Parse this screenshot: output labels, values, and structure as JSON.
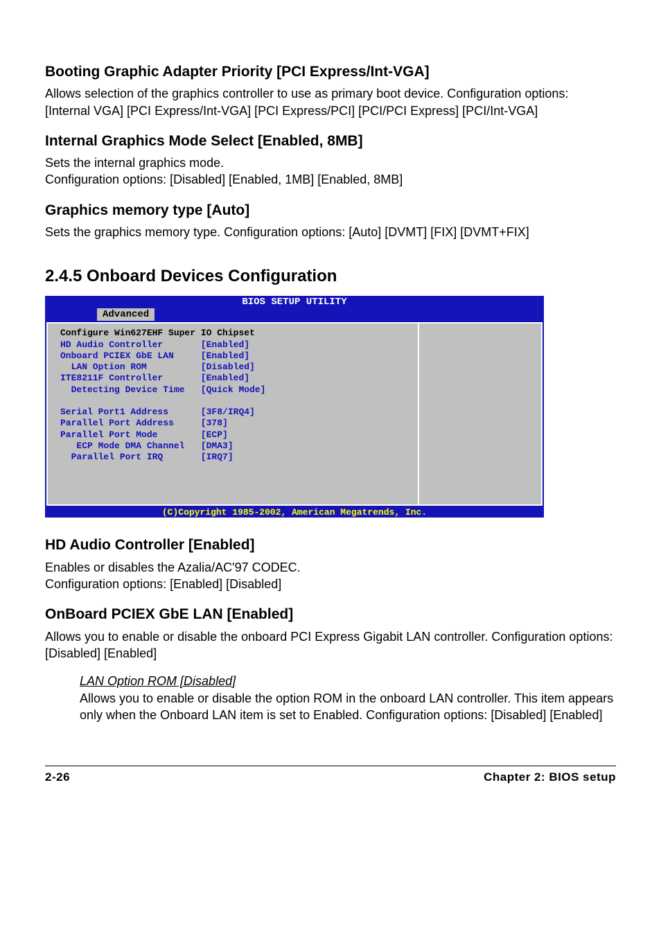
{
  "section1": {
    "title": "Booting Graphic Adapter Priority [PCI Express/Int-VGA]",
    "body": "Allows selection of the graphics controller to use as primary boot device. Configuration options: [Internal VGA] [PCI Express/Int-VGA] [PCI Express/PCI] [PCI/PCI Express] [PCI/Int-VGA]"
  },
  "section2": {
    "title": "Internal Graphics Mode Select [Enabled, 8MB]",
    "body": "Sets the internal graphics mode.\nConfiguration options: [Disabled] [Enabled, 1MB] [Enabled, 8MB]"
  },
  "section3": {
    "title": "Graphics memory type [Auto]",
    "body": "Sets the graphics memory type. Configuration options: [Auto] [DVMT] [FIX] [DVMT+FIX]"
  },
  "section_num_heading": "2.4.5   Onboard Devices Configuration",
  "bios": {
    "header": "BIOS SETUP UTILITY",
    "tab": "Advanced",
    "panel_title": "Configure Win627EHF Super IO Chipset",
    "rows": [
      {
        "label": "HD Audio Controller",
        "value": "[Enabled]"
      },
      {
        "label": "Onboard PCIEX GbE LAN",
        "value": "[Enabled]"
      },
      {
        "label": "  LAN Option ROM",
        "value": "[Disabled]"
      },
      {
        "label": "ITE8211F Controller",
        "value": "[Enabled]"
      },
      {
        "label": "  Detecting Device Time",
        "value": "[Quick Mode]"
      },
      {
        "label": "",
        "value": ""
      },
      {
        "label": "Serial Port1 Address",
        "value": "[3F8/IRQ4]"
      },
      {
        "label": "Parallel Port Address",
        "value": "[378]"
      },
      {
        "label": "Parallel Port Mode",
        "value": "[ECP]"
      },
      {
        "label": "   ECP Mode DMA Channel",
        "value": "[DMA3]"
      },
      {
        "label": "  Parallel Port IRQ",
        "value": "[IRQ7]"
      }
    ],
    "footer": "(C)Copyright 1985-2002, American Megatrends, Inc."
  },
  "section5": {
    "title": "HD Audio Controller [Enabled]",
    "body": "Enables or disables the Azalia/AC'97 CODEC.\nConfiguration options: [Enabled] [Disabled]"
  },
  "section6": {
    "title": "OnBoard PCIEX GbE LAN [Enabled]",
    "body": "Allows you to enable or disable the onboard PCI Express Gigabit LAN controller.  Configuration options: [Disabled] [Enabled]"
  },
  "sub1": {
    "title": "LAN Option ROM [Disabled]",
    "body": "Allows you to enable or disable the option ROM in the onboard LAN controller. This item appears only when the Onboard LAN item is set to Enabled. Configuration options: [Disabled] [Enabled]"
  },
  "footer": {
    "left": "2-26",
    "right": "Chapter 2: BIOS setup"
  }
}
